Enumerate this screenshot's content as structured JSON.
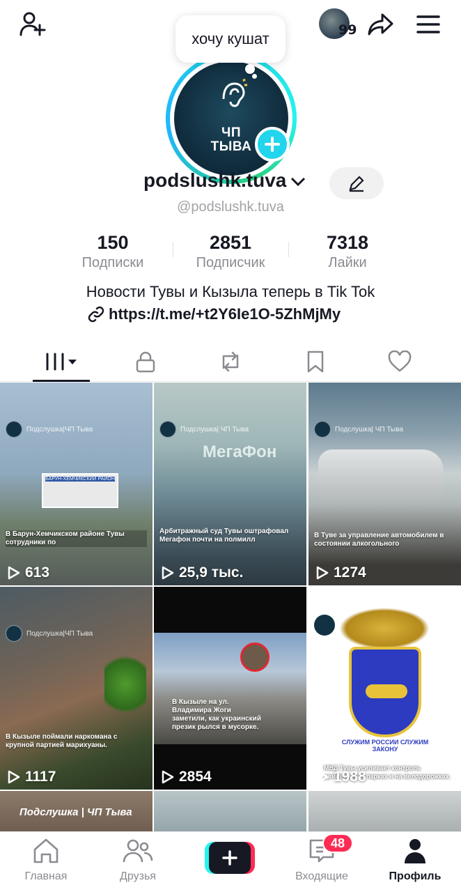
{
  "header": {
    "friend_count": "99",
    "icons": [
      "add-user-icon",
      "share-icon",
      "menu-icon"
    ]
  },
  "profile": {
    "note_bubble": "хочу кушат",
    "avatar_text_line1": "ЧП",
    "avatar_text_line2": "ТЫВА",
    "username": "podslushk.tuva",
    "handle": "@podslushk.tuva",
    "bio": "Новости Тувы и Кызыла теперь в Tik Tok",
    "link": "https://t.me/+t2Y6Ie1O-5ZhMjMy"
  },
  "stats": [
    {
      "value": "150",
      "label": "Подписки"
    },
    {
      "value": "2851",
      "label": "Подписчик"
    },
    {
      "value": "7318",
      "label": "Лайки"
    }
  ],
  "tabs": [
    "videos-grid-icon",
    "lock-icon",
    "repost-icon",
    "bookmark-icon",
    "heart-icon"
  ],
  "videos": [
    {
      "views": "613",
      "caption": "В Барун-Хемчикском районе Тувы сотрудники по",
      "watermark": "Подслушка|ЧП Тыва",
      "sign": "БАРУН-ХЕМЧИКСКИЙ РАЙОН"
    },
    {
      "views": "25,9 тыс.",
      "caption": "Арбитражный суд Тувы оштрафовал Мегафон почти на полмилл",
      "watermark": "Подслушка| ЧП Тыва",
      "sign": "МегаФон"
    },
    {
      "views": "1274",
      "caption": "В Туве за управление автомобилем в состоянии алкогольного",
      "watermark": "Подслушка| ЧП Тыва",
      "sign": ""
    },
    {
      "views": "1117",
      "caption": "В Кызыле поймали наркомана с крупной партией марихуаны.",
      "watermark": "Подслушка|ЧП Тыва",
      "sign": ""
    },
    {
      "views": "2854",
      "caption": "В Кызыле на ул. Владимира Жоги заметили, как украинский презик рылся в мусорке.",
      "watermark": "",
      "sign": ""
    },
    {
      "views": "1988",
      "caption": "МВД Тувы усиливает контроль движением в парках и на велодорожках.",
      "watermark": "",
      "sign": "СЛУЖИМ РОССИИ СЛУЖИМ ЗАКОНУ"
    }
  ],
  "partial_row": {
    "first_caption": "Подслушка | ЧП Тыва"
  },
  "bottom_nav": {
    "home": "Главная",
    "friends": "Друзья",
    "inbox": "Входящие",
    "inbox_badge": "48",
    "profile": "Профиль"
  }
}
